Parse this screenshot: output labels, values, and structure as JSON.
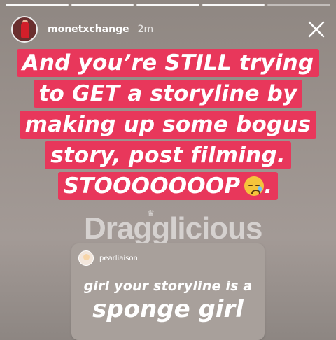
{
  "progress": {
    "total": 5,
    "completed": 4
  },
  "header": {
    "username": "monetxchange",
    "timestamp": "2m"
  },
  "caption": {
    "lines": [
      "And you’re STILL trying",
      "to GET a storyline by",
      "making up some bogus",
      "story, post filming.",
      "STOOOOOOOP"
    ],
    "emoji": "crying-face-emoji"
  },
  "watermark": {
    "text": "Dragglicious"
  },
  "card": {
    "username": "pearliaison",
    "small_text": "girl your storyline is a",
    "big_text": "sponge girl"
  },
  "colors": {
    "caption_bg": "#e8375b",
    "text": "#ffffff"
  }
}
